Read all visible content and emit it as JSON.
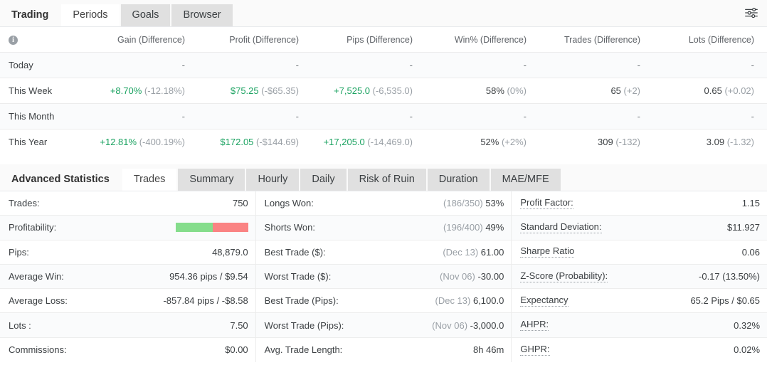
{
  "top_tabs": [
    {
      "label": "Trading",
      "state": "plain"
    },
    {
      "label": "Periods",
      "state": "active"
    },
    {
      "label": "Goals",
      "state": "normal"
    },
    {
      "label": "Browser",
      "state": "normal"
    }
  ],
  "settings_icon": "sliders-icon",
  "periods_table": {
    "info_icon": "i",
    "columns": [
      "Gain (Difference)",
      "Profit (Difference)",
      "Pips (Difference)",
      "Win% (Difference)",
      "Trades (Difference)",
      "Lots (Difference)"
    ],
    "rows": [
      {
        "period": "Today",
        "cells": [
          {
            "value": "-",
            "diff": "",
            "style": "dash"
          },
          {
            "value": "-",
            "diff": "",
            "style": "dash"
          },
          {
            "value": "-",
            "diff": "",
            "style": "dash"
          },
          {
            "value": "-",
            "diff": "",
            "style": "dash"
          },
          {
            "value": "-",
            "diff": "",
            "style": "dash"
          },
          {
            "value": "-",
            "diff": "",
            "style": "dash"
          }
        ]
      },
      {
        "period": "This Week",
        "cells": [
          {
            "value": "+8.70%",
            "diff": "(-12.18%)",
            "style": "pos"
          },
          {
            "value": "$75.25",
            "diff": "(-$65.35)",
            "style": "pos"
          },
          {
            "value": "+7,525.0",
            "diff": "(-6,535.0)",
            "style": "pos"
          },
          {
            "value": "58%",
            "diff": "(0%)",
            "style": "neutral"
          },
          {
            "value": "65",
            "diff": "(+2)",
            "style": "neutral"
          },
          {
            "value": "0.65",
            "diff": "(+0.02)",
            "style": "neutral"
          }
        ]
      },
      {
        "period": "This Month",
        "cells": [
          {
            "value": "-",
            "diff": "",
            "style": "dash"
          },
          {
            "value": "-",
            "diff": "",
            "style": "dash"
          },
          {
            "value": "-",
            "diff": "",
            "style": "dash"
          },
          {
            "value": "-",
            "diff": "",
            "style": "dash"
          },
          {
            "value": "-",
            "diff": "",
            "style": "dash"
          },
          {
            "value": "-",
            "diff": "",
            "style": "dash"
          }
        ]
      },
      {
        "period": "This Year",
        "cells": [
          {
            "value": "+12.81%",
            "diff": "(-400.19%)",
            "style": "pos"
          },
          {
            "value": "$172.05",
            "diff": "(-$144.69)",
            "style": "pos"
          },
          {
            "value": "+17,205.0",
            "diff": "(-14,469.0)",
            "style": "pos"
          },
          {
            "value": "52%",
            "diff": "(+2%)",
            "style": "neutral"
          },
          {
            "value": "309",
            "diff": "(-132)",
            "style": "neutral"
          },
          {
            "value": "3.09",
            "diff": "(-1.32)",
            "style": "neutral"
          }
        ]
      }
    ]
  },
  "stats_tabs": [
    {
      "label": "Advanced Statistics",
      "state": "plain"
    },
    {
      "label": "Trades",
      "state": "active"
    },
    {
      "label": "Summary",
      "state": "normal"
    },
    {
      "label": "Hourly",
      "state": "normal"
    },
    {
      "label": "Daily",
      "state": "normal"
    },
    {
      "label": "Risk of Ruin",
      "state": "normal"
    },
    {
      "label": "Duration",
      "state": "normal"
    },
    {
      "label": "MAE/MFE",
      "state": "normal"
    }
  ],
  "stats": {
    "left": [
      {
        "label": "Trades:",
        "value": "750",
        "prefix": ""
      },
      {
        "label": "Profitability:",
        "value": "",
        "prefix": "",
        "bar": {
          "green_pct": 51,
          "red_pct": 49,
          "green_color": "#85dd8c",
          "red_color": "#fa8383"
        }
      },
      {
        "label": "Pips:",
        "value": "48,879.0",
        "prefix": ""
      },
      {
        "label": "Average Win:",
        "value": "954.36 pips / $9.54",
        "prefix": ""
      },
      {
        "label": "Average Loss:",
        "value": "-857.84 pips / -$8.58",
        "prefix": ""
      },
      {
        "label": "Lots :",
        "value": "7.50",
        "prefix": ""
      },
      {
        "label": "Commissions:",
        "value": "$0.00",
        "prefix": ""
      }
    ],
    "middle": [
      {
        "label": "Longs Won:",
        "prefix": "(186/350)",
        "value": "53%"
      },
      {
        "label": "Shorts Won:",
        "prefix": "(196/400)",
        "value": "49%"
      },
      {
        "label": "Best Trade ($):",
        "prefix": "(Dec 13)",
        "value": "61.00"
      },
      {
        "label": "Worst Trade ($):",
        "prefix": "(Nov 06)",
        "value": "-30.00"
      },
      {
        "label": "Best Trade (Pips):",
        "prefix": "(Dec 13)",
        "value": "6,100.0"
      },
      {
        "label": "Worst Trade (Pips):",
        "prefix": "(Nov 06)",
        "value": "-3,000.0"
      },
      {
        "label": "Avg. Trade Length:",
        "prefix": "",
        "value": "8h 46m"
      }
    ],
    "right": [
      {
        "label": "Profit Factor:",
        "prefix": "",
        "value": "1.15",
        "tooltip": true
      },
      {
        "label": "Standard Deviation:",
        "prefix": "",
        "value": "$11.927",
        "tooltip": true
      },
      {
        "label": "Sharpe Ratio",
        "prefix": "",
        "value": "0.06",
        "tooltip": true
      },
      {
        "label": "Z-Score (Probability):",
        "prefix": "",
        "value": "-0.17 (13.50%)",
        "tooltip": true
      },
      {
        "label": "Expectancy",
        "prefix": "",
        "value": "65.2 Pips / $0.65",
        "tooltip": true
      },
      {
        "label": "AHPR:",
        "prefix": "",
        "value": "0.32%",
        "tooltip": true
      },
      {
        "label": "GHPR:",
        "prefix": "",
        "value": "0.02%",
        "tooltip": true
      }
    ]
  },
  "colors": {
    "positive": "#1aa260",
    "muted": "#9aa0a6",
    "tab_inactive": "#e0e0e0",
    "tab_active": "#ffffff"
  }
}
